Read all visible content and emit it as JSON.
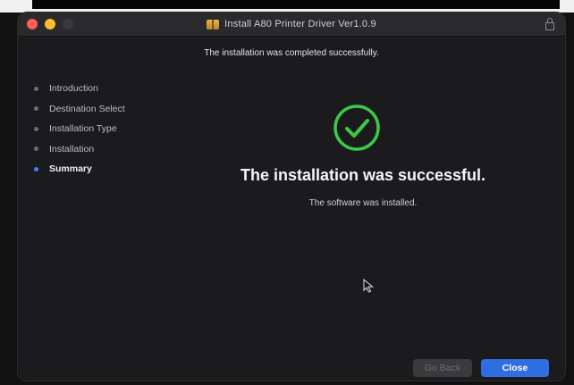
{
  "window": {
    "title": "Install A80 Printer Driver Ver1.0.9",
    "header_message": "The installation was completed successfully."
  },
  "sidebar": {
    "steps": [
      {
        "label": "Introduction",
        "active": false
      },
      {
        "label": "Destination Select",
        "active": false
      },
      {
        "label": "Installation Type",
        "active": false
      },
      {
        "label": "Installation",
        "active": false
      },
      {
        "label": "Summary",
        "active": true
      }
    ]
  },
  "main": {
    "status_icon": "checkmark-circle-icon",
    "title": "The installation was successful.",
    "subtitle": "The software was installed."
  },
  "buttons": {
    "go_back": "Go Back",
    "close": "Close"
  },
  "colors": {
    "success_green": "#3bc94a",
    "accent_blue": "#2f6ee0"
  }
}
